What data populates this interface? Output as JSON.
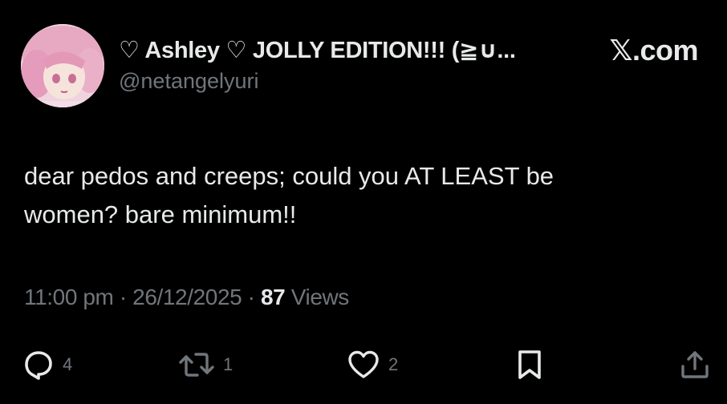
{
  "tweet": {
    "display_name": "♡ Ashley ♡ JOLLY EDITION!!! (≧∪...",
    "handle": "@netangelyuri",
    "source": "𝕏.com",
    "text_line1": "dear pedos and creeps; could you AT LEAST be",
    "text_line2": "women? bare minimum!!",
    "time": "11:00 pm",
    "sep1": " · ",
    "date": "26/12/2025",
    "sep2": " · ",
    "views_count": "87",
    "views_label": " Views"
  },
  "actions": {
    "reply_count": "4",
    "retweet_count": "1",
    "like_count": "2"
  },
  "icons": {
    "reply": "reply-icon",
    "retweet": "retweet-icon",
    "like": "heart-icon",
    "bookmark": "bookmark-icon",
    "share": "share-icon"
  },
  "colors": {
    "background": "#000000",
    "primary_text": "#e7e9ea",
    "secondary_text": "#71767b"
  }
}
